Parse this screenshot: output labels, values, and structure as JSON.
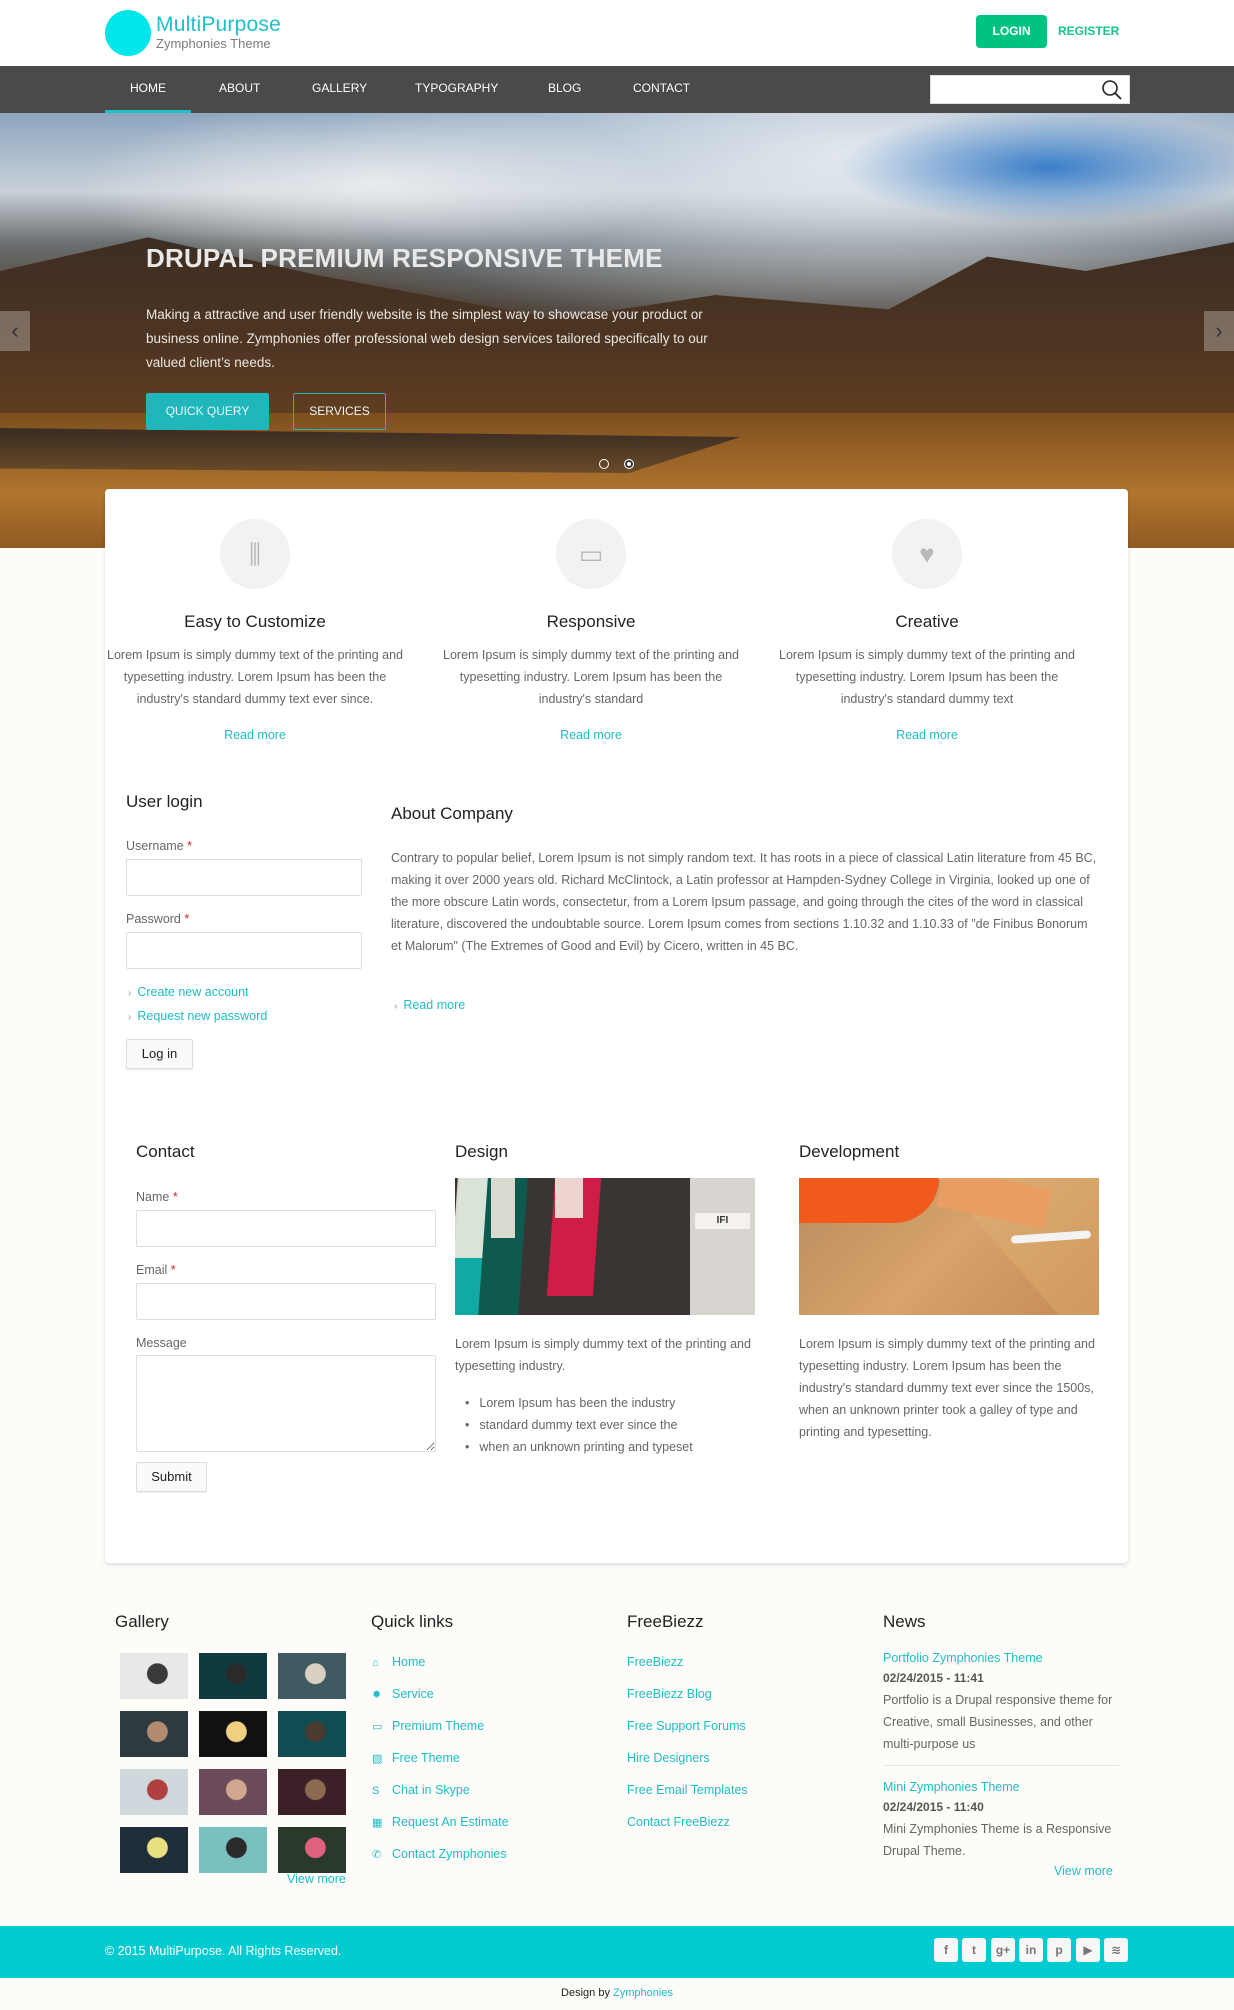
{
  "header": {
    "logo_title": "MultiPurpose",
    "logo_subtitle": "Zymphonies Theme",
    "login_label": "LOGIN",
    "register_label": "REGISTER",
    "accent_color": "#1fc1c9",
    "login_color": "#00c281"
  },
  "nav": {
    "items": [
      {
        "label": "HOME",
        "active": true
      },
      {
        "label": "ABOUT"
      },
      {
        "label": "GALLERY"
      },
      {
        "label": "TYPOGRAPHY"
      },
      {
        "label": "BLOG"
      },
      {
        "label": "CONTACT"
      }
    ],
    "search_value": "",
    "search_icon": "search-icon"
  },
  "hero": {
    "title": "DRUPAL PREMIUM RESPONSIVE THEME",
    "text": "Making a attractive and user friendly website is the simplest way to showcase your product or business online. Zymphonies offer professional web design services tailored specifically to our valued client’s needs.",
    "quick_query_label": "QUICK QUERY",
    "services_label": "SERVICES",
    "slides_count": 2,
    "active_slide": 2,
    "prev_icon": "chevron-left-icon",
    "next_icon": "chevron-right-icon"
  },
  "features": [
    {
      "icon": "sliders-icon",
      "title": "Easy to Customize",
      "text": "Lorem Ipsum is simply dummy text of the printing and typesetting industry. Lorem Ipsum has been the industry's standard dummy text ever since.",
      "link": "Read more"
    },
    {
      "icon": "monitor-icon",
      "title": "Responsive",
      "text": "Lorem Ipsum is simply dummy text of the printing and typesetting industry. Lorem Ipsum has been the industry's standard",
      "link": "Read more"
    },
    {
      "icon": "heart-icon",
      "title": "Creative",
      "text": "Lorem Ipsum is simply dummy text of the printing and typesetting industry. Lorem Ipsum has been the industry's standard dummy text",
      "link": "Read more"
    }
  ],
  "user_login": {
    "title": "User login",
    "username_label": "Username",
    "password_label": "Password",
    "required_mark": "*",
    "username_value": "",
    "password_value": "",
    "create_account": "Create new account",
    "request_password": "Request new password",
    "login_button": "Log in"
  },
  "about": {
    "title": "About Company",
    "text": "Contrary to popular belief, Lorem Ipsum is not simply random text. It has roots in a piece of classical Latin literature from 45 BC, making it over 2000 years old. Richard McClintock, a Latin professor at Hampden-Sydney College in Virginia, looked up one of the more obscure Latin words, consectetur, from a Lorem Ipsum passage, and going through the cites of the word in classical literature, discovered the undoubtable source. Lorem Ipsum comes from sections 1.10.32 and 1.10.33 of \"de Finibus Bonorum et Malorum\" (The Extremes of Good and Evil) by Cicero, written in 45 BC.",
    "read_more": "Read more"
  },
  "contact": {
    "title": "Contact",
    "name_label": "Name",
    "email_label": "Email",
    "message_label": "Message",
    "required_mark": "*",
    "name_value": "",
    "email_value": "",
    "message_value": "",
    "submit_label": "Submit"
  },
  "design": {
    "title": "Design",
    "text": "Lorem Ipsum is simply dummy text of the printing and typesetting industry.",
    "bullets": [
      "Lorem Ipsum has been the industry",
      "standard dummy text ever since the",
      "when an unknown printing and typeset"
    ]
  },
  "development": {
    "title": "Development",
    "text": "Lorem Ipsum is simply dummy text of the printing and typesetting industry. Lorem Ipsum has been the industry's standard dummy text ever since the 1500s, when an unknown printer took a galley of type and printing and typesetting."
  },
  "footer": {
    "gallery_title": "Gallery",
    "gallery_view_more": "View more",
    "gallery_thumbs": 12,
    "quick_links_title": "Quick links",
    "quick_links": [
      {
        "icon": "home-icon",
        "label": "Home"
      },
      {
        "icon": "gear-icon",
        "label": "Service"
      },
      {
        "icon": "laptop-icon",
        "label": "Premium Theme"
      },
      {
        "icon": "image-icon",
        "label": "Free Theme"
      },
      {
        "icon": "skype-icon",
        "label": "Chat in Skype"
      },
      {
        "icon": "table-icon",
        "label": "Request An Estimate"
      },
      {
        "icon": "phone-icon",
        "label": "Contact Zymphonies"
      }
    ],
    "freebiezz_title": "FreeBiezz",
    "freebiezz_links": [
      "FreeBiezz",
      "FreeBiezz Blog",
      "Free Support Forums",
      "Hire Designers",
      "Free Email Templates",
      "Contact FreeBiezz"
    ],
    "news_title": "News",
    "news": [
      {
        "title": "Portfolio Zymphonies Theme",
        "date": "02/24/2015 - 11:41",
        "body": "Portfolio is a Drupal responsive theme for Creative, small Businesses, and other multi-purpose us"
      },
      {
        "title": "Mini Zymphonies Theme",
        "date": "02/24/2015 - 11:40",
        "body": "Mini Zymphonies Theme is a Responsive Drupal Theme."
      }
    ],
    "news_view_more": "View more",
    "copyright": "© 2015 MultiPurpose. All Rights Reserved.",
    "social": [
      {
        "icon": "facebook-icon",
        "glyph": "f"
      },
      {
        "icon": "twitter-icon",
        "glyph": "t"
      },
      {
        "icon": "google-plus-icon",
        "glyph": "g+"
      },
      {
        "icon": "linkedin-icon",
        "glyph": "in"
      },
      {
        "icon": "pinterest-icon",
        "glyph": "p"
      },
      {
        "icon": "youtube-icon",
        "glyph": "▶"
      },
      {
        "icon": "rss-icon",
        "glyph": "≋"
      }
    ],
    "design_by_prefix": "Design by",
    "design_by_link": "Zymphonies",
    "bar_color": "#00cbd1"
  }
}
